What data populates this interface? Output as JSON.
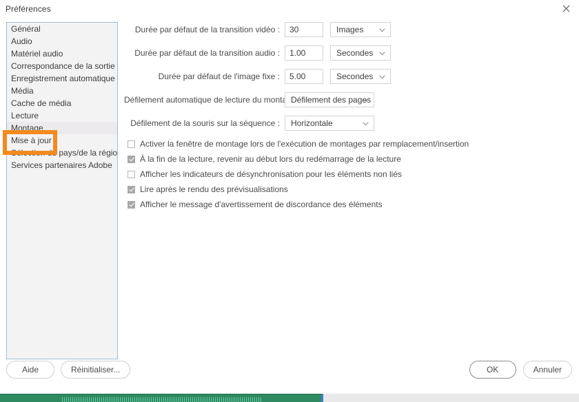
{
  "window": {
    "title": "Préférences",
    "close_icon": "close-icon"
  },
  "sidebar": {
    "items": [
      {
        "label": "Général",
        "selected": false
      },
      {
        "label": "Audio",
        "selected": false
      },
      {
        "label": "Matériel audio",
        "selected": false
      },
      {
        "label": "Correspondance de la sortie audio",
        "selected": false
      },
      {
        "label": "Enregistrement automatique",
        "selected": false
      },
      {
        "label": "Média",
        "selected": false
      },
      {
        "label": "Cache de média",
        "selected": false
      },
      {
        "label": "Lecture",
        "selected": false
      },
      {
        "label": "Montage",
        "selected": true
      },
      {
        "label": "Mise à jour",
        "selected": false
      },
      {
        "label": "Sélection du pays/de la région",
        "selected": false
      },
      {
        "label": "Services partenaires Adobe",
        "selected": false
      }
    ],
    "highlighted_item": "Montage",
    "highlight_color": "#f28b1e"
  },
  "settings": {
    "fields": [
      {
        "label": "Durée par défaut de la transition vidéo :",
        "value": "30",
        "unit": "Images",
        "unit_width": "narrow"
      },
      {
        "label": "Durée par défaut de la transition audio :",
        "value": "1.00",
        "unit": "Secondes",
        "unit_width": "narrow"
      },
      {
        "label": "Durée par défaut de l'image fixe :",
        "value": "5.00",
        "unit": "Secondes",
        "unit_width": "narrow"
      }
    ],
    "selects": [
      {
        "label": "Défilement automatique de lecture du montage :",
        "value": "Défilement des pages",
        "width": "wide"
      },
      {
        "label": "Défilement de la souris sur la séquence :",
        "value": "Horizontale",
        "width": "wide"
      }
    ],
    "checkboxes": [
      {
        "label": "Activer la fenêtre de montage lors de l'exécution de montages par remplacement/insertion",
        "checked": false
      },
      {
        "label": "À la fin de la lecture, revenir au début lors du redémarrage de la lecture",
        "checked": true
      },
      {
        "label": "Afficher les indicateurs de désynchronisation pour les éléments non liés",
        "checked": false
      },
      {
        "label": "Lire après le rendu des prévisualisations",
        "checked": true
      },
      {
        "label": "Afficher le message d'avertissement de discordance des éléments",
        "checked": true
      }
    ]
  },
  "footer": {
    "help_label": "Aide",
    "reset_label": "Réinitialiser...",
    "ok_label": "OK",
    "cancel_label": "Annuler"
  }
}
